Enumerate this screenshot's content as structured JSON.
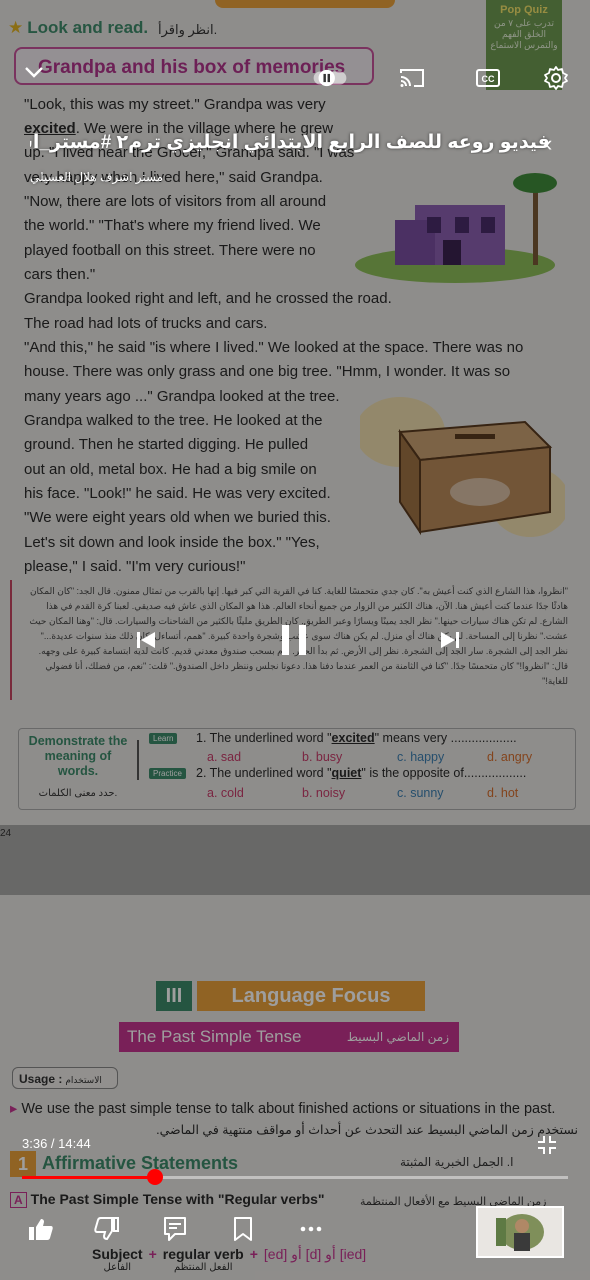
{
  "page": {
    "look_and_read": "Look and read.",
    "look_and_read_ar": "انظر واقرأ.",
    "pop_quiz": "Pop Quiz",
    "pop_quiz_ar": "تدرب على ٧ من الخلق الفهم والتمرس الاستماع",
    "story_title": "Grandpa and his box of memories",
    "story_lines": [
      "\"Look, this was my street.\" Grandpa was very",
      "excited. We were in the village where he grew",
      "up. \"I lived near the Grocer,\" Grandpa said. \"I was",
      "very happy when I lived here,\" said Grandpa.",
      "\"Now, there are lots of visitors from all around",
      "the world.\" \"That's where my friend lived. We",
      "played football on this street. There were no",
      "cars then.\"",
      "Grandpa looked right and left, and he crossed the road.",
      "The road had lots of trucks and cars.",
      "\"And this,\" he said \"is where I lived.\" We looked at the space. There was no",
      "house. There was only grass and one big tree. \"Hmm, I wonder. It was so",
      "many years ago ...\" Grandpa looked at the tree.",
      "Grandpa walked to the tree. He looked at the",
      "ground. Then he started digging. He pulled",
      "out an old, metal box. He had a big smile on",
      "his face. \"Look!\" he said. He was very excited.",
      "\"We were eight years old when we buried this.",
      "Let's sit down and look inside the box.\" \"Yes,",
      "please,\" I said. \"I'm very curious!\""
    ],
    "arabic_translation": "\"انظروا، هذا الشارع الذي كنت أعيش به\". كان جدي متحمسًا للغاية. كنا في القرية التي كبر فيها. إنها بالقرب من تمثال ممنون. قال الجد: \"كان المكان هادئًا جدًا عندما كنت أعيش هنا. الآن، هناك الكثير من الزوار من جميع أنحاء العالم. هذا هو المكان الذي عاش فيه صديقي. لعبنا كرة القدم في هذا الشارع. لم تكن هناك سيارات حينها.\" نظر الجد يمينًا ويسارًا وعبر الطريق. كان الطريق مليئًا بالكثير من الشاحنات والسيارات. قال: \"وهنا المكان حيث عشت.\" نظرنا إلى المساحة. لم يكن هناك أي منزل. لم يكن هناك سوى عشب وشجرة واحدة كبيرة. \"همم، أتساءل. كان ذلك منذ سنوات عديدة...\" نظر الجد إلى الشجرة. سار الجد إلى الشجرة. نظر إلى الأرض. ثم بدأ الحفر. قام بسحب صندوق معدني قديم. كانت لديه ابتسامة كبيرة على وجهه. قال: \"انظروا!\" كان متحمسًا جدًا. \"كنا في الثامنة من العمر عندما دفنا هذا. دعونا نجلس وننظر داخل الصندوق.\" قلت: \"نعم، من فضلك، أنا فضولي للغاية!\"",
    "demo_label": "Demonstrate the meaning of words.",
    "demo_label_ar": "حدد معنى الكلمات.",
    "learn_tag": "Learn",
    "practice_tag": "Practice",
    "q1": {
      "prefix": "1. The underlined word \"",
      "word": "excited",
      "suffix": "\" means very",
      "dots": "...................",
      "options": [
        "a. sad",
        "b. busy",
        "c. happy",
        "d. angry"
      ]
    },
    "q2": {
      "prefix": "2. The underlined word \"",
      "word": "quiet",
      "suffix": "\" is the opposite of",
      "dots": "..................",
      "options": [
        "a. cold",
        "b. noisy",
        "c. sunny",
        "d. hot"
      ]
    },
    "page_number": "24",
    "section_number": "III",
    "section_title": "Language Focus",
    "tense_title": "The Past Simple Tense",
    "tense_title_ar": "زمن الماضي البسيط",
    "usage_label": "Usage :",
    "usage_label_ar": "الاستخدام",
    "usage_text": "We use the past simple tense to talk about finished actions or situations in the past.",
    "usage_text_ar": "نستخدم زمن الماضي البسيط عند التحدث عن أحداث أو مواقف منتهية في الماضي.",
    "aff_number": "1",
    "aff_title": "Affirmative Statements",
    "aff_title_ar": "ا. الجمل الخبرية المثبتة",
    "regular_letter": "A",
    "regular_title": "The Past Simple Tense with \"Regular verbs\"",
    "regular_title_ar": "زمن الماضي البسيط مع الأفعال المنتظمة",
    "formula": {
      "subject": "Subject",
      "subject_ar": "الفاعل",
      "verb": "regular verb",
      "verb_ar": "الفعل المنتظم",
      "endings": "[ed] أو [d] أو [ied]"
    }
  },
  "player": {
    "video_title": "فيديو روعه للصف الرابع الابتدائي انجليزي ترم٢ #مستر_اش",
    "channel": "مستر اشرف هلال العسيلي",
    "current_time": "3:36",
    "duration": "14:44",
    "time_display": "3:36 / 14:44",
    "progress": 0.244,
    "accent": "#ff0000"
  }
}
